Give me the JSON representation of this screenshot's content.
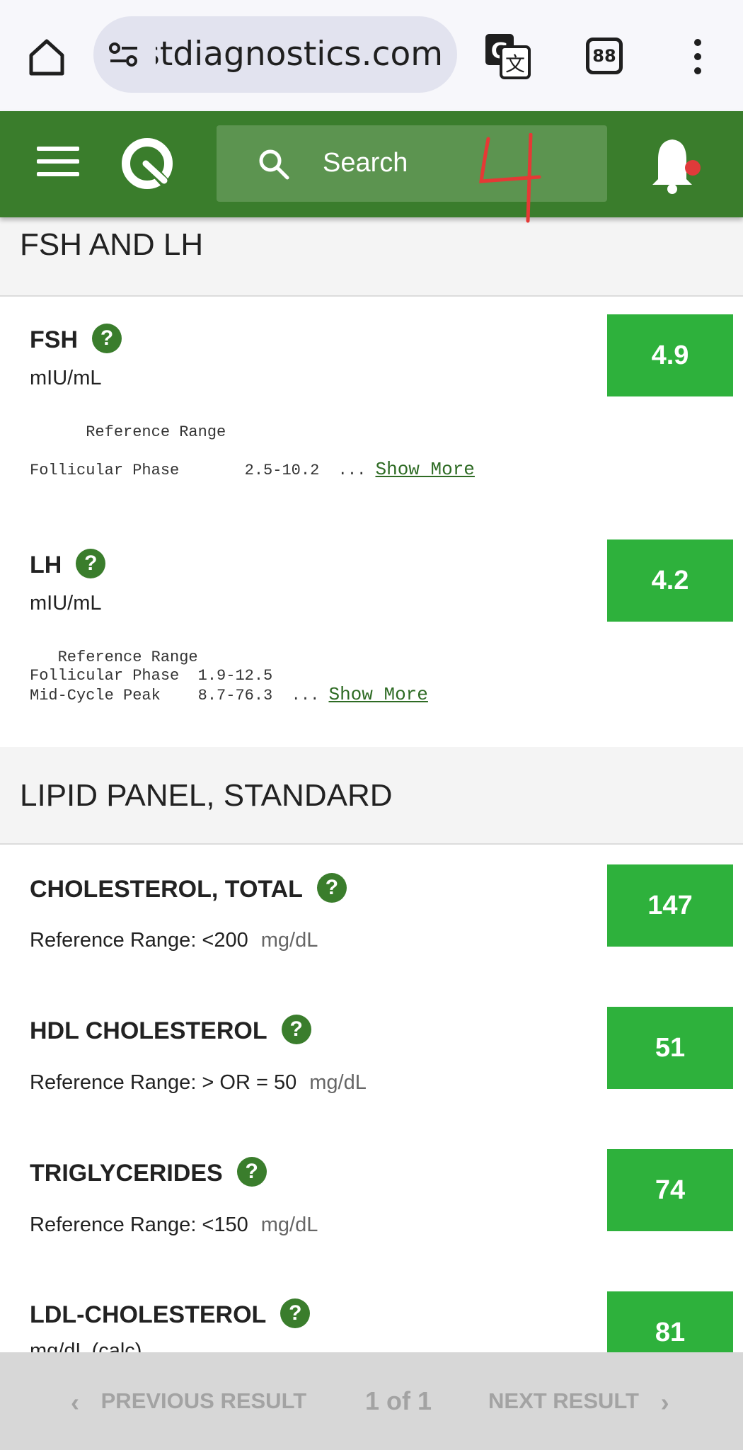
{
  "browser": {
    "url": "questdiagnostics.com",
    "tab_count": "88"
  },
  "header": {
    "search_placeholder": "Search",
    "handwritten_mark": "4"
  },
  "sections": [
    {
      "title": "FSH AND LH",
      "results": [
        {
          "name": "FSH",
          "unit": "mIU/mL",
          "value": "4.9",
          "reference_lines": [
            "      Reference Range",
            "",
            "Follicular Phase       2.5-10.2  ... "
          ],
          "show_more": "Show More"
        },
        {
          "name": "LH",
          "unit": "mIU/mL",
          "value": "4.2",
          "reference_lines": [
            "   Reference Range",
            "Follicular Phase  1.9-12.5",
            "Mid-Cycle Peak    8.7-76.3  ... "
          ],
          "show_more": "Show More"
        }
      ]
    },
    {
      "title": "LIPID PANEL, STANDARD",
      "results": [
        {
          "name": "CHOLESTEROL, TOTAL",
          "reference": "Reference Range: <200",
          "unit": "mg/dL",
          "value": "147"
        },
        {
          "name": "HDL CHOLESTEROL",
          "reference": "Reference Range: > OR = 50",
          "unit": "mg/dL",
          "value": "51"
        },
        {
          "name": "TRIGLYCERIDES",
          "reference": "Reference Range: <150",
          "unit": "mg/dL",
          "value": "74"
        },
        {
          "name": "LDL-CHOLESTEROL",
          "unit": "mg/dL (calc)",
          "value": "81"
        }
      ]
    }
  ],
  "pager": {
    "previous": "PREVIOUS RESULT",
    "count": "1 of 1",
    "next": "NEXT RESULT"
  },
  "colors": {
    "brand_green": "#3a7d2c",
    "value_green": "#2eb13c",
    "notification_dot": "#e03a3a",
    "scribble_red": "#e53935"
  },
  "icons": [
    "home-icon",
    "site-settings-icon",
    "translate-icon",
    "tab-switcher-icon",
    "more-vert-icon",
    "hamburger-icon",
    "quest-logo",
    "search-icon",
    "bell-icon",
    "help-icon",
    "chevron-left-icon",
    "chevron-right-icon"
  ]
}
